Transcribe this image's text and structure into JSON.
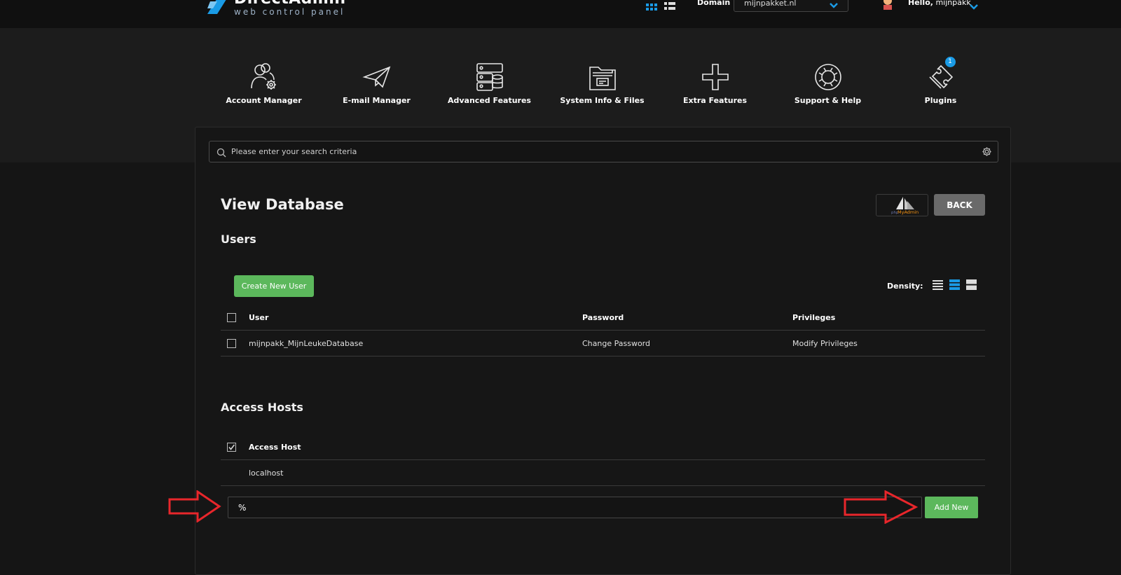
{
  "topbar": {
    "logo_title": "DirectAdmin",
    "logo_subtitle": "web control panel",
    "domain_label": "Domain",
    "domain_value": "mijnpakket.nl",
    "hello_prefix": "Hello,",
    "username": "mijnpakk"
  },
  "nav": {
    "items": [
      {
        "label": "Account Manager",
        "icon": "account-manager-icon"
      },
      {
        "label": "E-mail Manager",
        "icon": "paper-plane-icon"
      },
      {
        "label": "Advanced Features",
        "icon": "server-database-icon"
      },
      {
        "label": "System Info & Files",
        "icon": "folder-icon"
      },
      {
        "label": "Extra Features",
        "icon": "plus-icon"
      },
      {
        "label": "Support & Help",
        "icon": "lifebuoy-icon"
      },
      {
        "label": "Plugins",
        "icon": "puzzle-icon",
        "badge": "1"
      }
    ]
  },
  "search": {
    "placeholder": "Please enter your search criteria"
  },
  "page": {
    "title": "View Database",
    "back_label": "BACK",
    "pma_logo_text": "phpMyAdmin"
  },
  "users": {
    "title": "Users",
    "create_label": "Create New User",
    "density_label": "Density:",
    "columns": [
      "User",
      "Password",
      "Privileges"
    ],
    "rows": [
      {
        "user": "mijnpakk_MijnLeukeDatabase",
        "password": "Change Password",
        "privileges": "Modify Privileges"
      }
    ]
  },
  "hosts": {
    "title": "Access Hosts",
    "column": "Access Host",
    "rows": [
      "localhost"
    ],
    "new_value": "%",
    "add_label": "Add New"
  },
  "colors": {
    "accent_green": "#5cb85c",
    "accent_blue": "#1a9be6",
    "annotation_red": "#e8262b"
  }
}
